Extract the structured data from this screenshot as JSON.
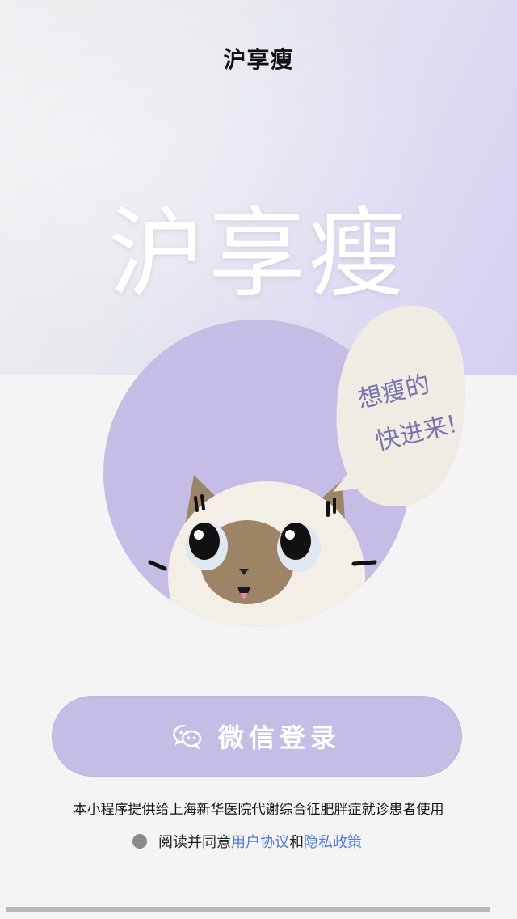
{
  "nav": {
    "title": "沪享瘦"
  },
  "hero": {
    "logo_text": "沪享瘦"
  },
  "mascot": {
    "bubble_line1": "想瘦的",
    "bubble_line2": "快进来!"
  },
  "login": {
    "button_label": "微信登录",
    "icon": "wechat-icon"
  },
  "notice": {
    "text": "本小程序提供给上海新华医院代谢综合征肥胖症就诊患者使用"
  },
  "agreement": {
    "prefix": "阅读并同意",
    "user_agreement": "用户协议",
    "and": "和",
    "privacy_policy": "隐私政策"
  },
  "colors": {
    "accent": "#c4bee6",
    "link": "#4f7ad8",
    "circle": "#c5bde6"
  }
}
